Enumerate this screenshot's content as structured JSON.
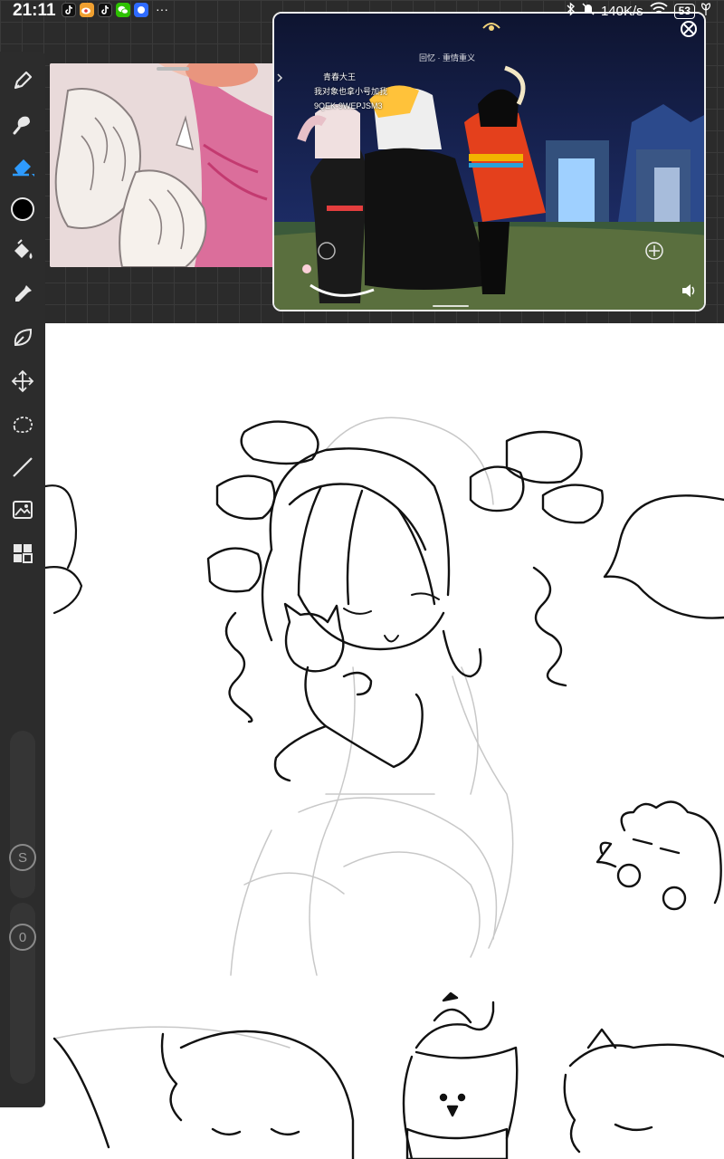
{
  "status_bar": {
    "time": "21:11",
    "more": "···",
    "network_speed": "140K/s",
    "battery": "53"
  },
  "video": {
    "chat_lines": [
      "青春大王",
      "我对象也拿小号加我",
      "9QEK-9WEPJSM3"
    ],
    "overlay_label": "回忆 · 重情重义"
  },
  "toolbar": {
    "tools": [
      "brush",
      "smudge",
      "eraser",
      "color",
      "fill",
      "eyedropper",
      "liquify",
      "transform",
      "selection",
      "line",
      "import-image",
      "layers"
    ],
    "active_tool": "eraser",
    "current_color": "#000000",
    "size_slider_label": "S",
    "opacity_slider_label": "0",
    "accent": "#2e9bff"
  },
  "colors": {
    "toolbar_bg": "#2c2c2c",
    "workspace_bg": "#2b2b2b",
    "canvas_bg": "#ffffff"
  }
}
